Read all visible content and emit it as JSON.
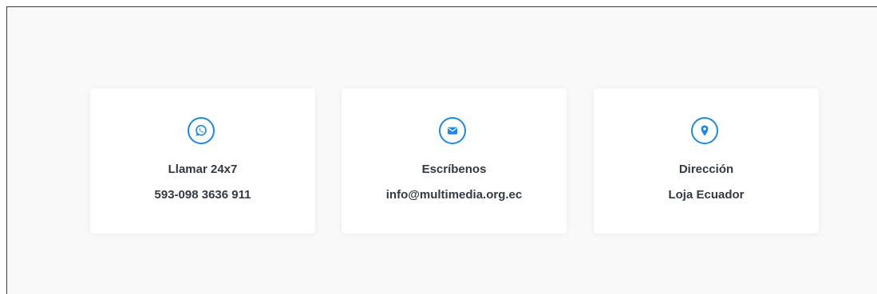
{
  "accent_color": "#1e88e5",
  "cards": [
    {
      "icon": "whatsapp-icon",
      "title": "Llamar 24x7",
      "value": "593-098 3636 911"
    },
    {
      "icon": "envelope-icon",
      "title": "Escríbenos",
      "value": "info@multimedia.org.ec"
    },
    {
      "icon": "map-marker-icon",
      "title": "Dirección",
      "value": "Loja Ecuador"
    }
  ]
}
